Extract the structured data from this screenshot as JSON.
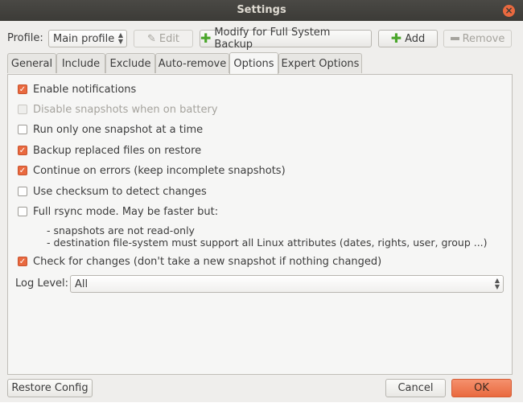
{
  "window": {
    "title": "Settings"
  },
  "profile": {
    "label": "Profile:",
    "selected": "Main profile",
    "edit": "Edit",
    "modify": "Modify for Full System Backup",
    "add": "Add",
    "remove": "Remove"
  },
  "tabs": [
    "General",
    "Include",
    "Exclude",
    "Auto-remove",
    "Options",
    "Expert Options"
  ],
  "active_tab": "Options",
  "options": [
    {
      "label": "Enable notifications",
      "checked": true,
      "enabled": true
    },
    {
      "label": "Disable snapshots when on battery",
      "checked": false,
      "enabled": false
    },
    {
      "label": "Run only one snapshot at a time",
      "checked": false,
      "enabled": true
    },
    {
      "label": "Backup replaced files on restore",
      "checked": true,
      "enabled": true
    },
    {
      "label": "Continue on errors (keep incomplete snapshots)",
      "checked": true,
      "enabled": true
    },
    {
      "label": "Use checksum to detect changes",
      "checked": false,
      "enabled": true
    },
    {
      "label": "Full rsync mode. May be faster but:",
      "checked": false,
      "enabled": true
    },
    {
      "label": "Check for changes (don't take a new snapshot if nothing changed)",
      "checked": true,
      "enabled": true
    }
  ],
  "rsync_notes": [
    "- snapshots are not read-only",
    "- destination file-system must support all Linux attributes (dates, rights, user, group ...)"
  ],
  "log_level": {
    "label": "Log Level:",
    "selected": "All"
  },
  "buttons": {
    "restore": "Restore Config",
    "cancel": "Cancel",
    "ok": "OK"
  },
  "colors": {
    "accent": "#e9693f",
    "titlebar": "#3c3b37",
    "add_icon": "#4aa62b"
  }
}
